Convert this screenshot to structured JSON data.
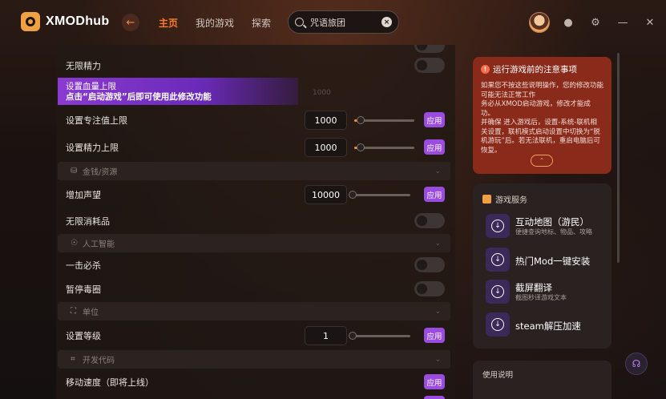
{
  "app": {
    "name": "XMODhub"
  },
  "nav": {
    "items": [
      {
        "label": "主页",
        "active": true
      },
      {
        "label": "我的游戏",
        "active": false
      },
      {
        "label": "探索",
        "active": false
      }
    ]
  },
  "search": {
    "value": "咒语旅团"
  },
  "main": {
    "rows": {
      "infinite_stamina": "无限精力",
      "set_hp_max": "设置血量上限",
      "set_focus_max": "设置专注值上限",
      "focus_value": "1000",
      "set_stamina_max": "设置精力上限",
      "stamina_value": "1000",
      "add_reputation": "增加声望",
      "reputation_value": "10000",
      "infinite_consumables": "无限消耗品",
      "one_hit_kill": "一击必杀",
      "pause_poison_circle": "暂停毒圈",
      "set_level": "设置等级",
      "level_value": "1",
      "move_speed": "移动速度（即将上线）",
      "ghost_value": "1000"
    },
    "apply_label": "应用",
    "sections": {
      "money": "金钱/资源",
      "ai": "人工智能",
      "unit": "单位",
      "dev": "开发代码"
    },
    "tooltip": {
      "line1": "设置血量上限",
      "line2": "点击“启动游戏”后即可使用此修改功能"
    }
  },
  "notice": {
    "title": "运行游戏前的注意事项",
    "body": "如果您不按这些说明操作，您的修改功能可能无法正常工作\n务必从XMOD启动游戏，修改才能成功。\n并确保 进入游戏后，设置-系统-联机相关设置，联机模式启动设置中切换为“脱机游玩”后。若无法联机，重启电脑后可恢复。"
  },
  "services": {
    "title": "游戏服务",
    "items": [
      {
        "name": "互动地图（游民）",
        "sub": "便捷查询地标、物品、攻略"
      },
      {
        "name": "热门Mod一键安装",
        "sub": ""
      },
      {
        "name": "截屏翻译",
        "sub": "截图秒译游戏文本"
      },
      {
        "name": "steam解压加速",
        "sub": ""
      }
    ]
  },
  "usage": {
    "label": "使用说明"
  },
  "colors": {
    "accent": "#ff7a2e",
    "apply": "#9a4be0",
    "notice_bg": "#8a2a1a"
  }
}
